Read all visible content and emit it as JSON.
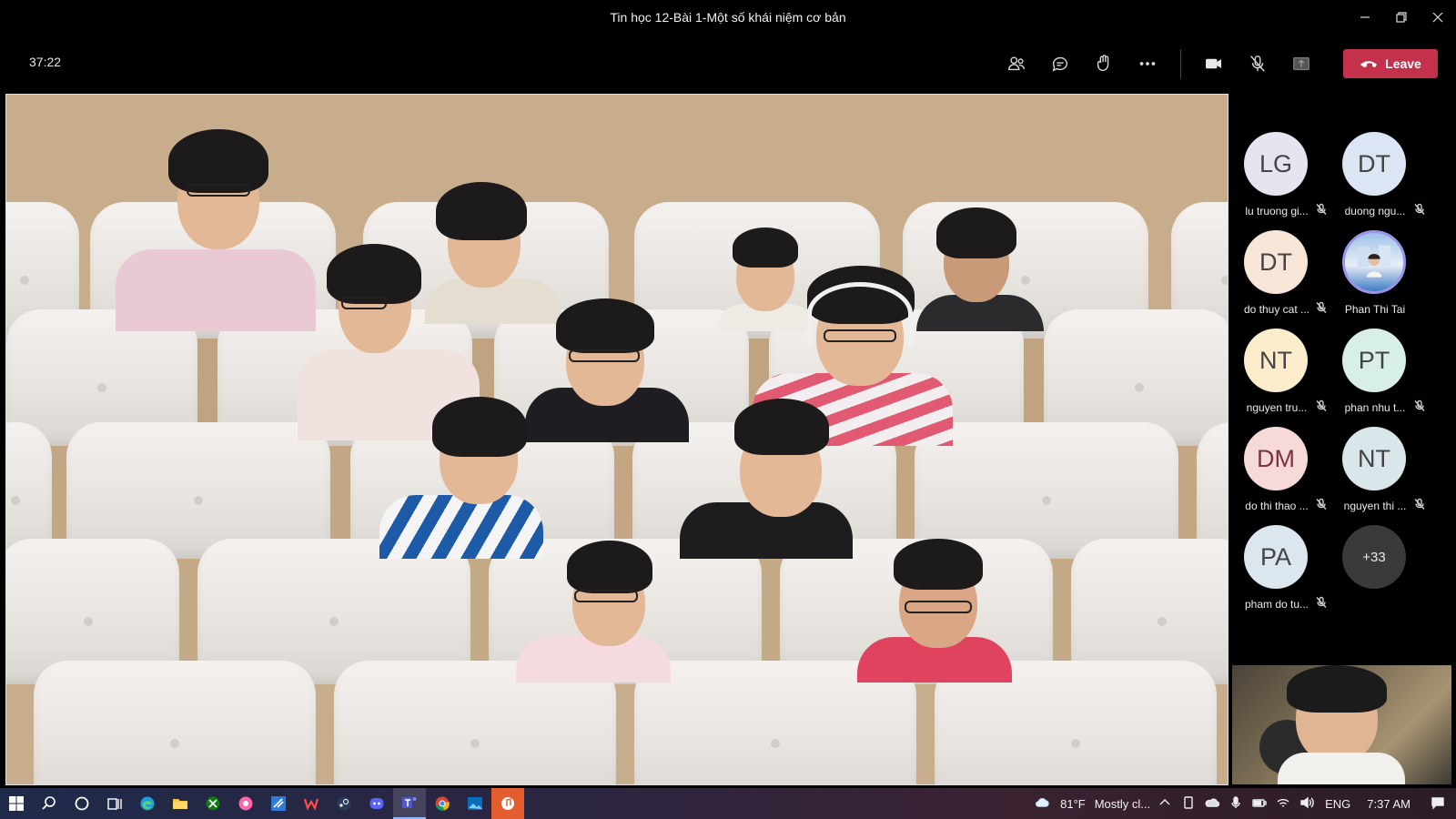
{
  "window": {
    "title": "Tin học 12-Bài 1-Một số khái niệm cơ bản"
  },
  "meeting": {
    "timer": "37:22",
    "leave_label": "Leave",
    "leave_color": "#c4314b"
  },
  "toolbar_icons": [
    "people-icon",
    "chat-icon",
    "reactions-icon",
    "more-options-icon",
    "camera-icon",
    "mic-muted-icon",
    "share-tray-icon"
  ],
  "participants": [
    {
      "initials": "LG",
      "name": "lu truong gi...",
      "color": "#e7e4f0",
      "muted": true
    },
    {
      "initials": "DT",
      "name": "duong ngu...",
      "color": "#dbe5f4",
      "muted": true
    },
    {
      "initials": "DT",
      "name": "do thuy cat ...",
      "color": "#f7e6d7",
      "muted": true
    },
    {
      "initials": "",
      "name": "Phan Thi Tai",
      "color": "#cfd8ea",
      "muted": false,
      "photo": true
    },
    {
      "initials": "NT",
      "name": "nguyen tru...",
      "color": "#fbeccc",
      "muted": true
    },
    {
      "initials": "PT",
      "name": "phan nhu t...",
      "color": "#d7efe5",
      "muted": true
    },
    {
      "initials": "DM",
      "name": "do thi thao ...",
      "color": "#f6dad9",
      "muted": true
    },
    {
      "initials": "NT",
      "name": "nguyen thi ...",
      "color": "#d9e6ea",
      "muted": true
    },
    {
      "initials": "PA",
      "name": "pham do tu...",
      "color": "#dbe6ee",
      "muted": true
    }
  ],
  "more_participants": "+33",
  "taskbar": {
    "weather_temp": "81°F",
    "weather_text": "Mostly cl...",
    "language": "ENG",
    "time": "7:37 AM"
  }
}
